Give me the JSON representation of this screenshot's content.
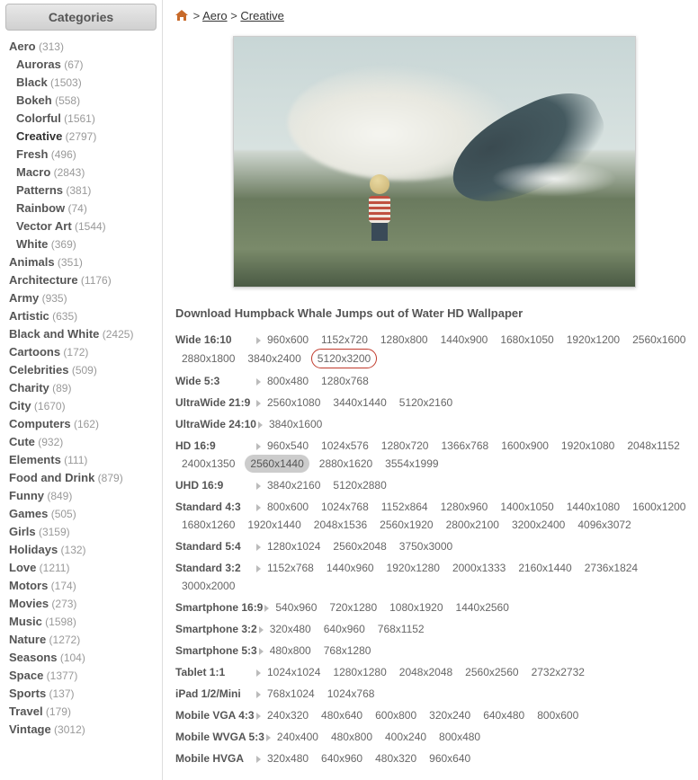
{
  "sidebar": {
    "title": "Categories",
    "items": [
      {
        "name": "Aero",
        "count": 313,
        "sub": false,
        "active": false
      },
      {
        "name": "Auroras",
        "count": 67,
        "sub": true,
        "active": false
      },
      {
        "name": "Black",
        "count": 1503,
        "sub": true,
        "active": false
      },
      {
        "name": "Bokeh",
        "count": 558,
        "sub": true,
        "active": false
      },
      {
        "name": "Colorful",
        "count": 1561,
        "sub": true,
        "active": false
      },
      {
        "name": "Creative",
        "count": 2797,
        "sub": true,
        "active": true
      },
      {
        "name": "Fresh",
        "count": 496,
        "sub": true,
        "active": false
      },
      {
        "name": "Macro",
        "count": 2843,
        "sub": true,
        "active": false
      },
      {
        "name": "Patterns",
        "count": 381,
        "sub": true,
        "active": false
      },
      {
        "name": "Rainbow",
        "count": 74,
        "sub": true,
        "active": false
      },
      {
        "name": "Vector Art",
        "count": 1544,
        "sub": true,
        "active": false
      },
      {
        "name": "White",
        "count": 369,
        "sub": true,
        "active": false
      },
      {
        "name": "Animals",
        "count": 351,
        "sub": false,
        "active": false
      },
      {
        "name": "Architecture",
        "count": 1176,
        "sub": false,
        "active": false
      },
      {
        "name": "Army",
        "count": 935,
        "sub": false,
        "active": false
      },
      {
        "name": "Artistic",
        "count": 635,
        "sub": false,
        "active": false
      },
      {
        "name": "Black and White",
        "count": 2425,
        "sub": false,
        "active": false
      },
      {
        "name": "Cartoons",
        "count": 172,
        "sub": false,
        "active": false
      },
      {
        "name": "Celebrities",
        "count": 509,
        "sub": false,
        "active": false
      },
      {
        "name": "Charity",
        "count": 89,
        "sub": false,
        "active": false
      },
      {
        "name": "City",
        "count": 1670,
        "sub": false,
        "active": false
      },
      {
        "name": "Computers",
        "count": 162,
        "sub": false,
        "active": false
      },
      {
        "name": "Cute",
        "count": 932,
        "sub": false,
        "active": false
      },
      {
        "name": "Elements",
        "count": 111,
        "sub": false,
        "active": false
      },
      {
        "name": "Food and Drink",
        "count": 879,
        "sub": false,
        "active": false
      },
      {
        "name": "Funny",
        "count": 849,
        "sub": false,
        "active": false
      },
      {
        "name": "Games",
        "count": 505,
        "sub": false,
        "active": false
      },
      {
        "name": "Girls",
        "count": 3159,
        "sub": false,
        "active": false
      },
      {
        "name": "Holidays",
        "count": 132,
        "sub": false,
        "active": false
      },
      {
        "name": "Love",
        "count": 1211,
        "sub": false,
        "active": false
      },
      {
        "name": "Motors",
        "count": 174,
        "sub": false,
        "active": false
      },
      {
        "name": "Movies",
        "count": 273,
        "sub": false,
        "active": false
      },
      {
        "name": "Music",
        "count": 1598,
        "sub": false,
        "active": false
      },
      {
        "name": "Nature",
        "count": 1272,
        "sub": false,
        "active": false
      },
      {
        "name": "Seasons",
        "count": 104,
        "sub": false,
        "active": false
      },
      {
        "name": "Space",
        "count": 1377,
        "sub": false,
        "active": false
      },
      {
        "name": "Sports",
        "count": 137,
        "sub": false,
        "active": false
      },
      {
        "name": "Travel",
        "count": 179,
        "sub": false,
        "active": false
      },
      {
        "name": "Vintage",
        "count": 3012,
        "sub": false,
        "active": false
      }
    ]
  },
  "breadcrumb": {
    "sep": " > ",
    "items": [
      "Aero",
      "Creative"
    ]
  },
  "download_title": "Download Humpback Whale Jumps out of Water HD Wallpaper",
  "groups": [
    {
      "label": "Wide 16:10",
      "links": [
        "960x600",
        "1152x720",
        "1280x800",
        "1440x900",
        "1680x1050",
        "1920x1200",
        "2560x1600",
        "2880x1800",
        "3840x2400",
        "5120x3200"
      ],
      "circled": "5120x3200"
    },
    {
      "label": "Wide 5:3",
      "links": [
        "800x480",
        "1280x768"
      ]
    },
    {
      "label": "UltraWide 21:9",
      "links": [
        "2560x1080",
        "3440x1440",
        "5120x2160"
      ]
    },
    {
      "label": "UltraWide 24:10",
      "links": [
        "3840x1600"
      ]
    },
    {
      "label": "HD 16:9",
      "links": [
        "960x540",
        "1024x576",
        "1280x720",
        "1366x768",
        "1600x900",
        "1920x1080",
        "2048x1152",
        "2400x1350",
        "2560x1440",
        "2880x1620",
        "3554x1999"
      ],
      "current": "2560x1440"
    },
    {
      "label": "UHD 16:9",
      "links": [
        "3840x2160",
        "5120x2880"
      ]
    },
    {
      "label": "Standard 4:3",
      "links": [
        "800x600",
        "1024x768",
        "1152x864",
        "1280x960",
        "1400x1050",
        "1440x1080",
        "1600x1200",
        "1680x1260",
        "1920x1440",
        "2048x1536",
        "2560x1920",
        "2800x2100",
        "3200x2400",
        "4096x3072"
      ]
    },
    {
      "label": "Standard 5:4",
      "links": [
        "1280x1024",
        "2560x2048",
        "3750x3000"
      ]
    },
    {
      "label": "Standard 3:2",
      "links": [
        "1152x768",
        "1440x960",
        "1920x1280",
        "2000x1333",
        "2160x1440",
        "2736x1824",
        "3000x2000"
      ]
    },
    {
      "label": "Smartphone 16:9",
      "links": [
        "540x960",
        "720x1280",
        "1080x1920",
        "1440x2560"
      ]
    },
    {
      "label": "Smartphone 3:2",
      "links": [
        "320x480",
        "640x960",
        "768x1152"
      ]
    },
    {
      "label": "Smartphone 5:3",
      "links": [
        "480x800",
        "768x1280"
      ]
    },
    {
      "label": "Tablet 1:1",
      "links": [
        "1024x1024",
        "1280x1280",
        "2048x2048",
        "2560x2560",
        "2732x2732"
      ]
    },
    {
      "label": "iPad 1/2/Mini",
      "links": [
        "768x1024",
        "1024x768"
      ]
    },
    {
      "label": "Mobile VGA 4:3",
      "links": [
        "240x320",
        "480x640",
        "600x800",
        "320x240",
        "640x480",
        "800x600"
      ]
    },
    {
      "label": "Mobile WVGA 5:3",
      "links": [
        "240x400",
        "480x800",
        "400x240",
        "800x480"
      ]
    },
    {
      "label": "Mobile HVGA",
      "links": [
        "320x480",
        "640x960",
        "480x320",
        "960x640"
      ]
    }
  ]
}
